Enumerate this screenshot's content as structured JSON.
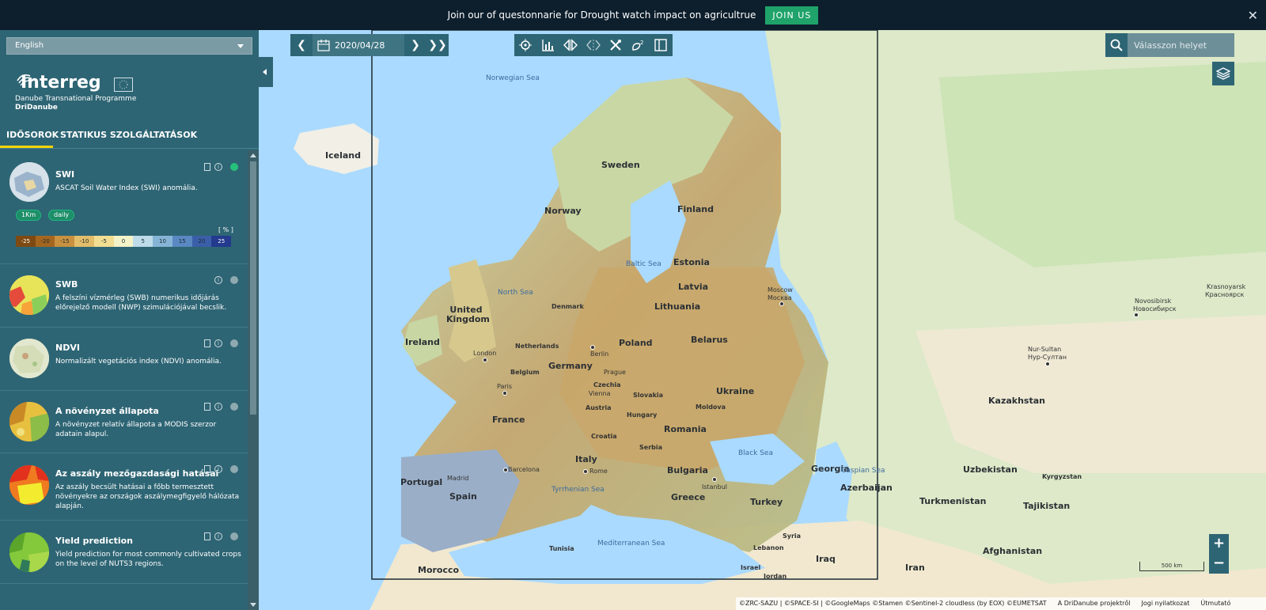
{
  "banner": {
    "text": "Join our of questonnarie for Drought watch impact on agricultrue",
    "join_label": "JOIN US",
    "close_icon": "✕"
  },
  "sidebar": {
    "language": "English",
    "logo": {
      "name": "Interreg",
      "programme": "Danube Transnational Programme",
      "project": "DriDanube"
    },
    "tabs": [
      {
        "label": "IDŐSOROK"
      },
      {
        "label": "STATIKUS SZOLGÁLTATÁSOK"
      }
    ],
    "layers": [
      {
        "title": "SWI",
        "desc": "ASCAT Soil Water Index (SWI) anomália.",
        "badges": [
          "1Km",
          "daily"
        ],
        "legend_unit": "[ % ]",
        "legend_ticks": [
          "-25",
          "-20",
          "-15",
          "-10",
          "-5",
          "0",
          "5",
          "10",
          "15",
          "20",
          "25"
        ],
        "active": true
      },
      {
        "title": "SWB",
        "desc": "A felszíni vízmérleg (SWB) numerikus időjárás előrejelző modell (NWP) szimulációjával becslik."
      },
      {
        "title": "NDVI",
        "desc": "Normalizált vegetációs index (NDVI) anomália."
      },
      {
        "title": "A növényzet állapota",
        "desc": "A növényzet relatív állapota a MODIS szerzor adatain alapul."
      },
      {
        "title": "Az aszály mezőgazdasági hatásai",
        "desc": "Az aszály becsült hatásai a főbb termesztett növényekre az országok aszálymegfigyelő hálózata alapján."
      },
      {
        "title": "Yield prediction",
        "desc": "Yield prediction for most commonly cultivated crops on the level of NUTS3 regions."
      }
    ]
  },
  "toolbar": {
    "date": "2020/04/28"
  },
  "search": {
    "placeholder": "Válasszon helyet"
  },
  "map": {
    "countries": [
      "Iceland",
      "Sweden",
      "Norway",
      "Finland",
      "Estonia",
      "Latvia",
      "Lithuania",
      "United Kingdom",
      "Ireland",
      "Denmark",
      "Netherlands",
      "Belgium",
      "Germany",
      "Poland",
      "Belarus",
      "Czechia",
      "Slovakia",
      "Austria",
      "Hungary",
      "Ukraine",
      "Moldova",
      "France",
      "Romania",
      "Croatia",
      "Serbia",
      "Italy",
      "Bulgaria",
      "Portugal",
      "Spain",
      "Greece",
      "Turkey",
      "Georgia",
      "Azerbaijan",
      "Kazakhstan",
      "Uzbekistan",
      "Turkmenistan",
      "Kyrgyzstan",
      "Tajikistan",
      "Afghanistan",
      "Iran",
      "Iraq",
      "Syria",
      "Tunisia",
      "Morocco",
      "Lebanon",
      "Israel",
      "Jordan"
    ],
    "cities": [
      "London",
      "Paris",
      "Berlin",
      "Prague",
      "Vienna",
      "Barcelona",
      "Rome",
      "Madrid",
      "Istanbul",
      "Moscow",
      "Москва",
      "Krasnoyarsk",
      "Красноярск",
      "Novosibirsk",
      "Новосибирск",
      "Nur-Sultan",
      "Нур-Султан"
    ],
    "seas": [
      "Norwegian Sea",
      "Baltic Sea",
      "North Sea",
      "Black Sea",
      "Caspian Sea",
      "Tyrrhenian Sea",
      "Mediterranean Sea"
    ],
    "scale_label": "500 km",
    "attribution": [
      "©ZRC-SAZU | ©SPACE-SI | ©GoogleMaps ©Stamen ©Sentinel-2 cloudless (by EOX) ©EUMETSAT",
      "A DriDanube projektről",
      "Jogi nyilatkozat",
      "Útmutató"
    ]
  },
  "colors": {
    "panel": "#2e6574",
    "accent": "#1fa36a",
    "tab_underline": "#f2d300"
  }
}
